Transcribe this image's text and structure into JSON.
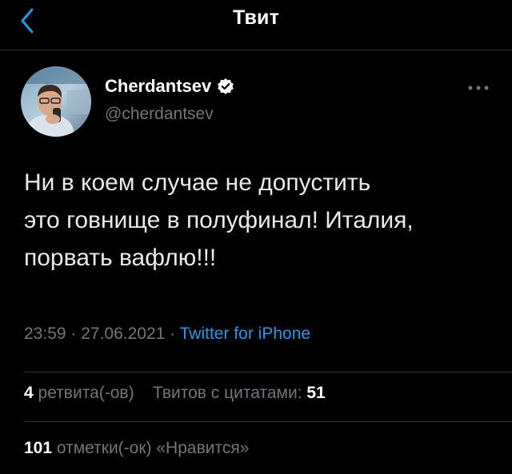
{
  "header": {
    "title": "Твит",
    "back_icon": "chevron-left-icon",
    "accent_color": "#1d9bf0"
  },
  "author": {
    "display_name": "Cherdantsev",
    "handle": "@cherdantsev",
    "verified_icon": "verified-badge-icon"
  },
  "tweet": {
    "lines": [
      "Ни в коем случае не допустить",
      "это говнище в полуфинал! Италия,",
      "порвать вафлю!!!"
    ]
  },
  "meta": {
    "time": "23:59",
    "sep1": " · ",
    "date": "27.06.2021",
    "sep2": " · ",
    "source": "Twitter for iPhone"
  },
  "stats": {
    "retweets_count": "4",
    "retweets_label": "ретвита(-ов)",
    "quotes_label": "Твитов с цитатами:",
    "quotes_count": "51",
    "likes_count": "101",
    "likes_label": "отметки(-ок) «Нравится»"
  }
}
